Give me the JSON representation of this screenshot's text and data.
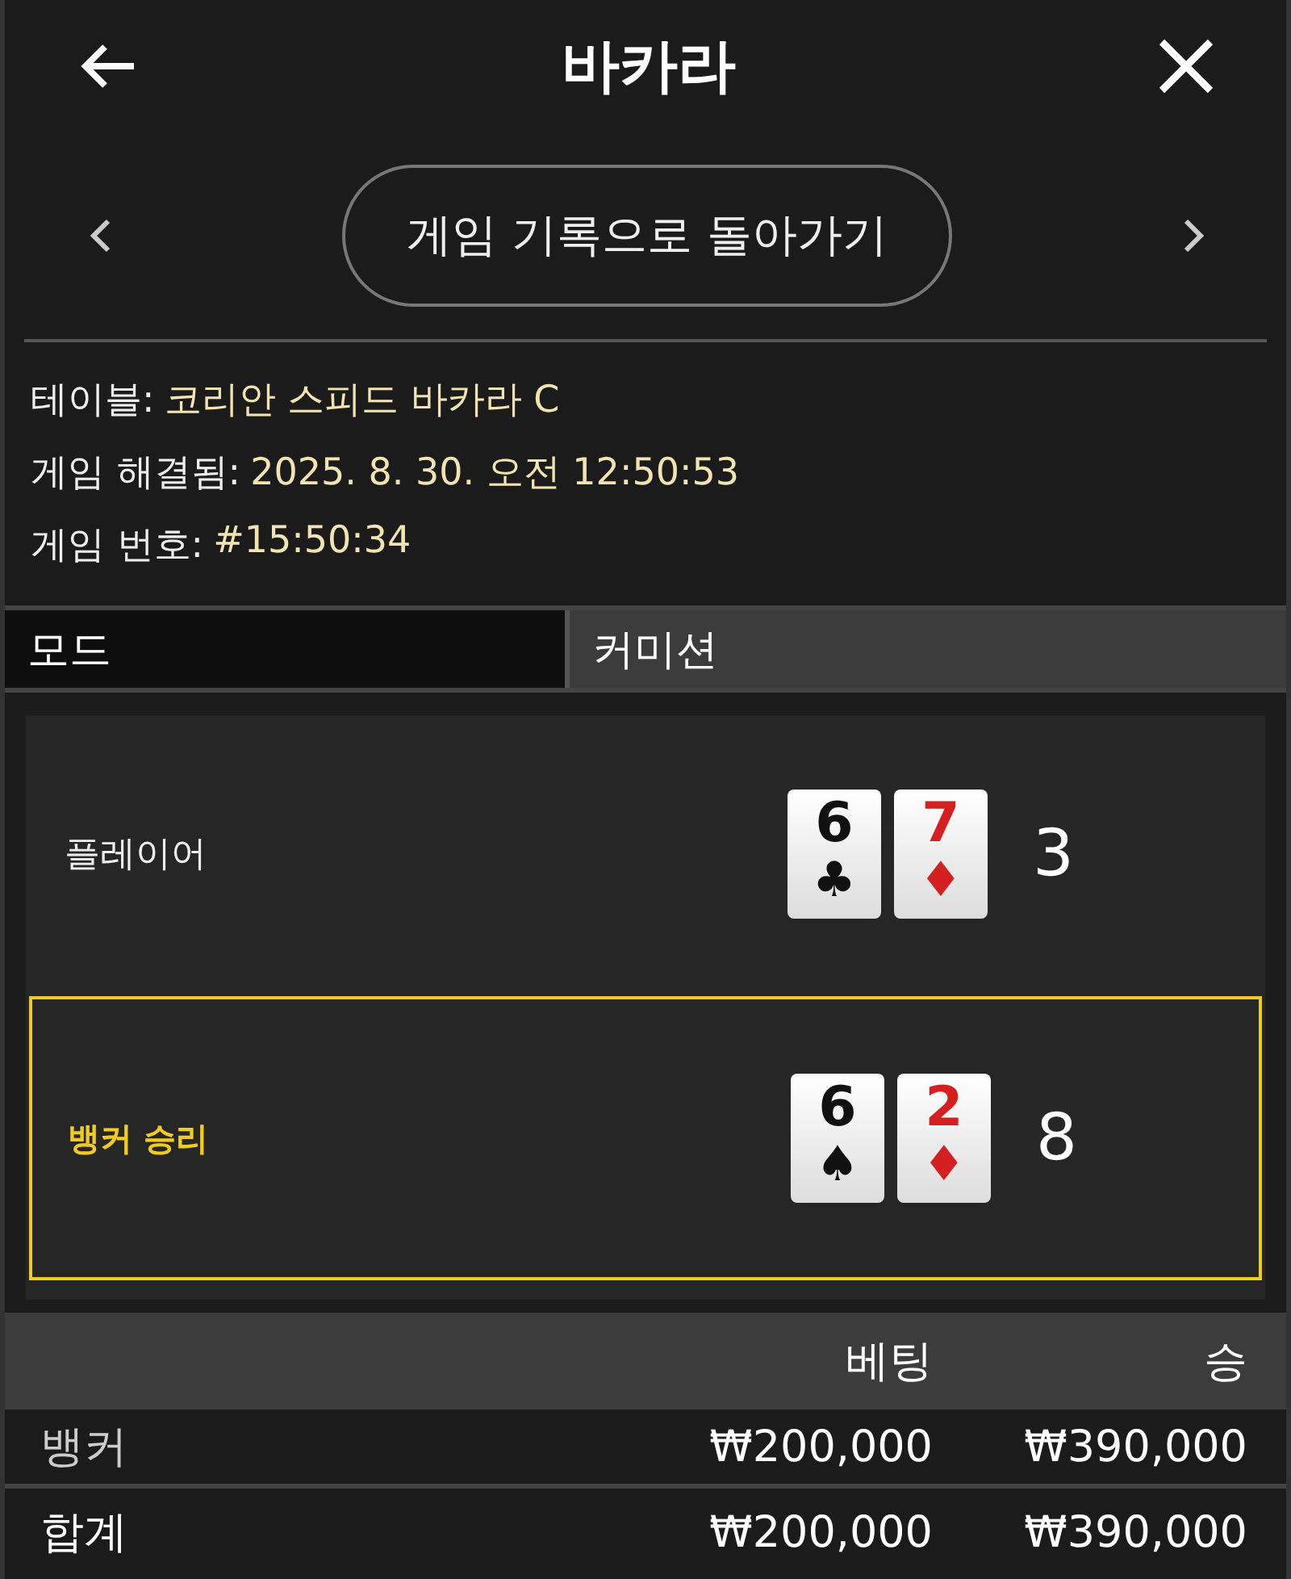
{
  "header": {
    "title": "바카라"
  },
  "nav": {
    "button": "게임 기록으로 돌아가기"
  },
  "info": [
    {
      "label": "테이블:",
      "value": "코리안 스피드 바카라 C"
    },
    {
      "label": "게임 해결됨:",
      "value": "2025. 8. 30. 오전 12:50:53"
    },
    {
      "label": "게임 번호:",
      "value": "#15:50:34"
    }
  ],
  "mode": {
    "label": "모드",
    "value": "커미션"
  },
  "hands": [
    {
      "name": "플레이어",
      "winner": false,
      "score": "3",
      "cards": [
        {
          "rank": "6",
          "suit": "♣",
          "color": "#111111"
        },
        {
          "rank": "7",
          "suit": "♦",
          "color": "#d42020"
        }
      ]
    },
    {
      "name": "뱅커 승리",
      "winner": true,
      "score": "8",
      "cards": [
        {
          "rank": "6",
          "suit": "♠",
          "color": "#111111"
        },
        {
          "rank": "2",
          "suit": "♦",
          "color": "#d42020"
        }
      ]
    }
  ],
  "bets": {
    "columns": [
      "베팅",
      "승"
    ],
    "rows": [
      {
        "label": "뱅커",
        "bet": "₩200,000",
        "win": "₩390,000"
      }
    ],
    "total": {
      "label": "합계",
      "bet": "₩200,000",
      "win": "₩390,000"
    }
  }
}
